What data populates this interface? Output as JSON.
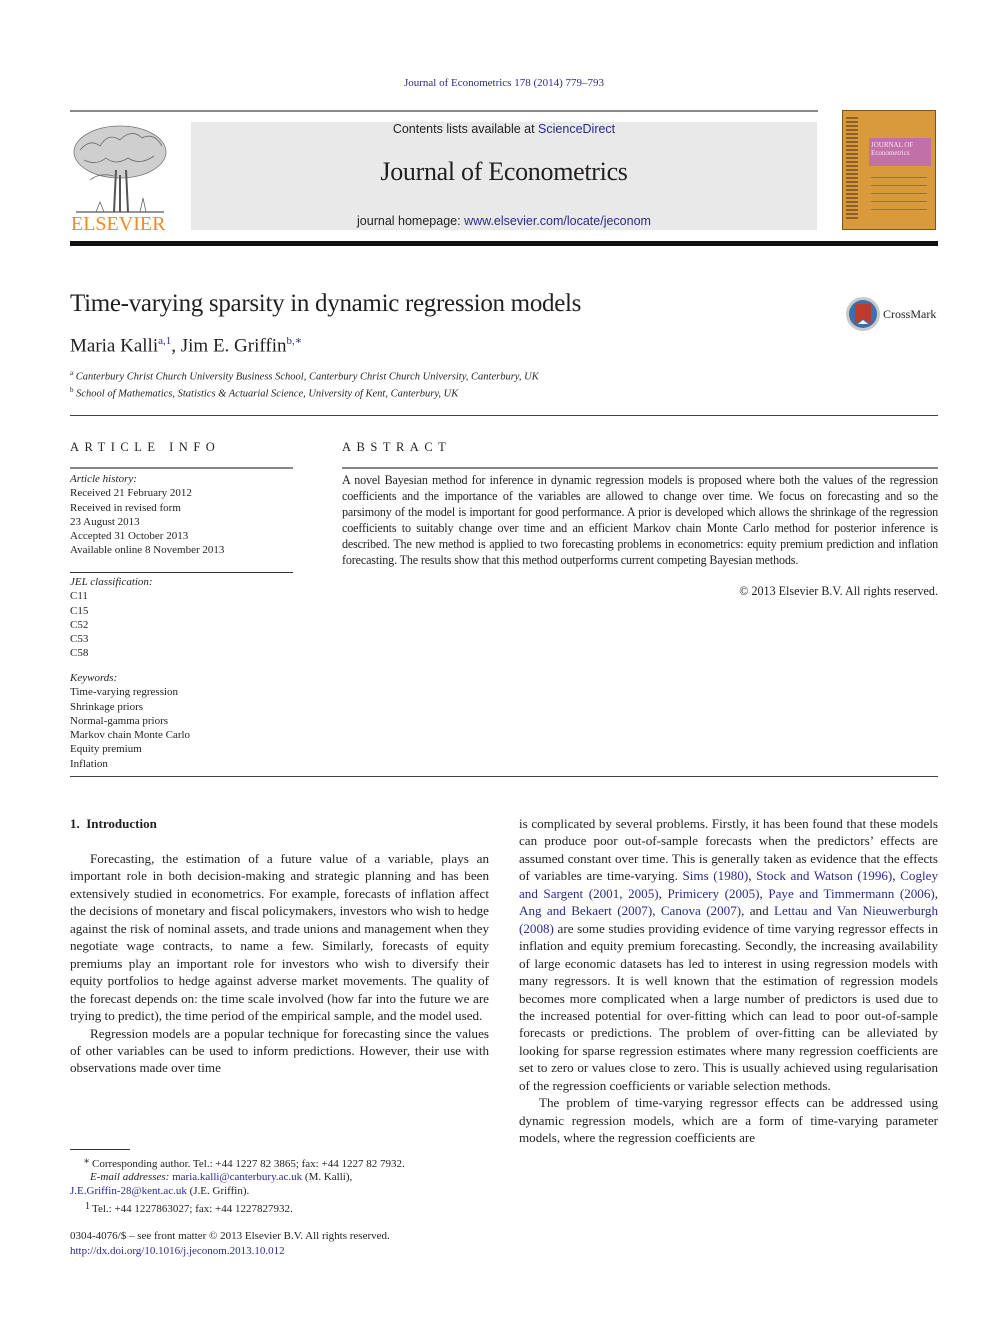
{
  "header": {
    "journal_reference": "Journal of Econometrics 178 (2014) 779–793",
    "contents_prefix": "Contents lists available at ",
    "contents_link": "ScienceDirect",
    "journal_name": "Journal of Econometrics",
    "homepage_prefix": "journal homepage: ",
    "homepage_link": "www.elsevier.com/locate/jeconom",
    "publisher_logo_text": "ELSEVIER",
    "cover_title_line1": "JOURNAL OF",
    "cover_title_line2": "Econometrics"
  },
  "article": {
    "title": "Time-varying sparsity in dynamic regression models",
    "crossmark_label": "CrossMark",
    "authors": [
      {
        "name": "Maria Kalli",
        "marks": "a,1"
      },
      {
        "name": "Jim E. Griffin",
        "marks": "b,∗"
      }
    ],
    "author_separator": ", ",
    "affiliations": [
      {
        "mark": "a",
        "text": "Canterbury Christ Church University Business School, Canterbury Christ Church University, Canterbury, UK"
      },
      {
        "mark": "b",
        "text": "School of Mathematics, Statistics & Actuarial Science, University of Kent, Canterbury, UK"
      }
    ]
  },
  "article_info": {
    "heading": "ARTICLE INFO",
    "history_label": "Article history:",
    "history": [
      "Received 21 February 2012",
      "Received in revised form",
      "23 August 2013",
      "Accepted 31 October 2013",
      "Available online 8 November 2013"
    ],
    "jel_label": "JEL classification:",
    "jel": [
      "C11",
      "C15",
      "C52",
      "C53",
      "C58"
    ],
    "keywords_label": "Keywords:",
    "keywords": [
      "Time-varying regression",
      "Shrinkage priors",
      "Normal-gamma priors",
      "Markov chain Monte Carlo",
      "Equity premium",
      "Inflation"
    ]
  },
  "abstract": {
    "heading": "ABSTRACT",
    "text": "A novel Bayesian method for inference in dynamic regression models is proposed where both the values of the regression coefficients and the importance of the variables are allowed to change over time. We focus on forecasting and so the parsimony of the model is important for good performance. A prior is developed which allows the shrinkage of the regression coefficients to suitably change over time and an efficient Markov chain Monte Carlo method for posterior inference is described. The new method is applied to two forecasting problems in econometrics: equity premium prediction and inflation forecasting. The results show that this method outperforms current competing Bayesian methods.",
    "copyright": "© 2013 Elsevier B.V. All rights reserved."
  },
  "introduction": {
    "heading": "1.  Introduction",
    "left_p1": "Forecasting, the estimation of a future value of a variable, plays an important role in both decision-making and strategic planning and has been extensively studied in econometrics. For example, forecasts of inflation affect the decisions of monetary and fiscal policymakers, investors who wish to hedge against the risk of nominal assets, and trade unions and management when they negotiate wage contracts, to name a few. Similarly, forecasts of equity premiums play an important role for investors who wish to diversify their equity portfolios to hedge against adverse market movements. The quality of the forecast depends on: the time scale involved (how far into the future we are trying to predict), the time period of the empirical sample, and the model used.",
    "left_p2": "Regression models are a popular technique for forecasting since the values of other variables can be used to inform predictions. However, their use with observations made over time",
    "right_p1_start": "is complicated by several problems. Firstly, it has been found that these models can produce poor out-of-sample forecasts when the predictors’ effects are assumed constant over time. This is generally taken as evidence that the effects of variables are time-varying. ",
    "citations": [
      {
        "text": "Sims (1980)",
        "after": ", "
      },
      {
        "text": "Stock and Watson (1996)",
        "after": ", "
      },
      {
        "text": "Cogley and Sargent (2001, 2005)",
        "after": ", "
      },
      {
        "text": "Primicery (2005)",
        "after": ", "
      },
      {
        "text": "Paye and Timmermann (2006)",
        "after": ", "
      },
      {
        "text": "Ang and Bekaert (2007)",
        "after": ", "
      },
      {
        "text": "Canova (2007)",
        "after": ", and "
      },
      {
        "text": "Lettau and Van Nieuwerburgh (2008)",
        "after": ""
      }
    ],
    "right_p1_end": " are some studies providing evidence of time varying regressor effects in inflation and equity premium forecasting. Secondly, the increasing availability of large economic datasets has led to interest in using regression models with many regressors. It is well known that the estimation of regression models becomes more complicated when a large number of predictors is used due to the increased potential for over-fitting which can lead to poor out-of-sample forecasts or predictions. The problem of over-fitting can be alleviated by looking for sparse regression estimates where many regression coefficients are set to zero or values close to zero. This is usually achieved using regularisation of the regression coefficients or variable selection methods.",
    "right_p2": "The problem of time-varying regressor effects can be addressed using dynamic regression models, which are a form of time-varying parameter models, where the regression coefficients are"
  },
  "footnotes": {
    "corresponding_mark": "∗",
    "corresponding_text": "Corresponding author. Tel.: +44 1227 82 3865; fax: +44 1227 82 7932.",
    "email_label": "E-mail addresses: ",
    "email1": "maria.kalli@canterbury.ac.uk",
    "email1_owner": " (M. Kalli),",
    "email2": "J.E.Griffin-28@kent.ac.uk",
    "email2_owner": " (J.E. Griffin).",
    "note1_mark": "1",
    "note1_text": "Tel.: +44 1227863027; fax: +44 1227827932.",
    "front_matter": "0304-4076/$ – see front matter © 2013 Elsevier B.V. All rights reserved.",
    "doi": "http://dx.doi.org/10.1016/j.jeconom.2013.10.012"
  },
  "colors": {
    "link": "#2b2b8c",
    "elsevier_orange": "#f08a24",
    "cover_orange": "#d99a3c",
    "cover_pink": "#c270a8",
    "banner_gray": "#e9e9e9"
  }
}
